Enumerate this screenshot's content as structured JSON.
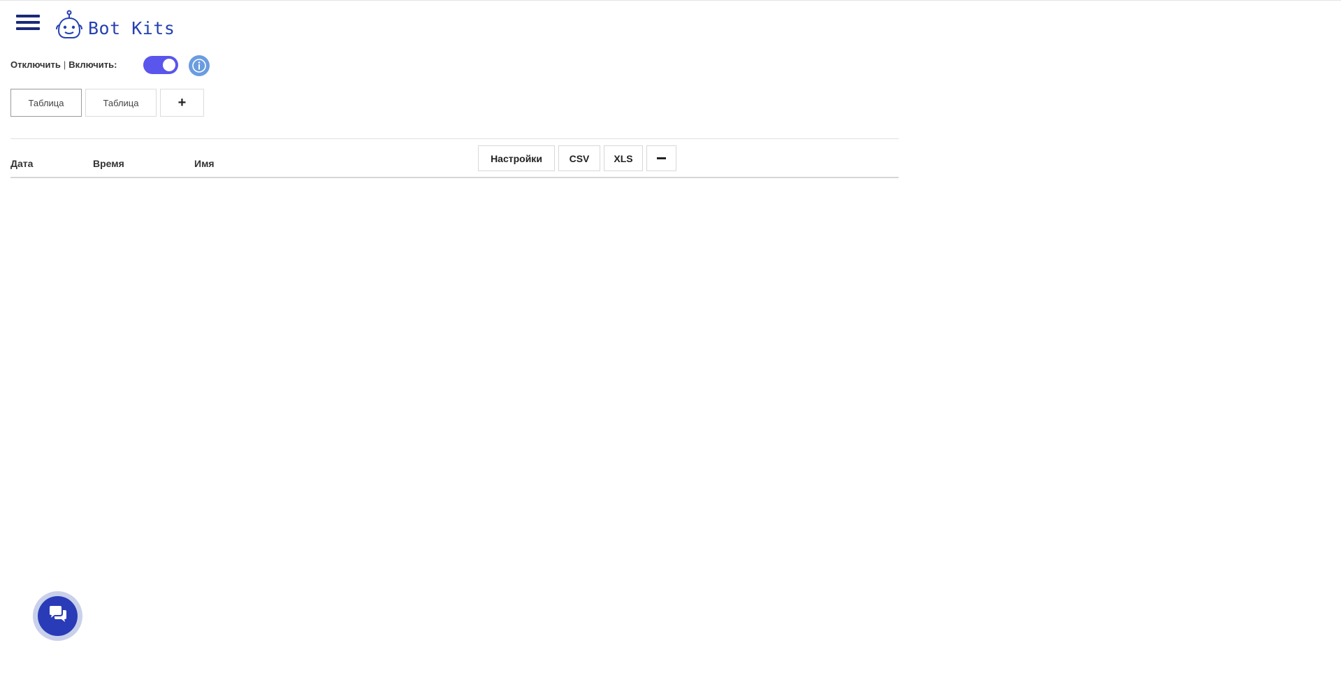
{
  "header": {
    "logo_text": "Bot Kits"
  },
  "toggle": {
    "label_off": "Отключить",
    "separator": "|",
    "label_on": "Включить:",
    "state": "on",
    "color": "#5a55ec"
  },
  "tabs": [
    {
      "label": "Таблица",
      "active": true
    },
    {
      "label": "Таблица",
      "active": false
    }
  ],
  "add_tab_label": "+",
  "table": {
    "columns": [
      "Дата",
      "Время",
      "Имя"
    ],
    "rows": []
  },
  "toolbar": {
    "settings_label": "Настройки",
    "csv_label": "CSV",
    "xls_label": "XLS"
  },
  "colors": {
    "brand": "#2541b2",
    "hamburger": "#1a2a7a",
    "info": "#6a9ce0",
    "chat": "#2a3bb8"
  },
  "icons": {
    "menu": "hamburger-icon",
    "logo": "robot-icon",
    "info": "info-icon",
    "chat": "chat-icon"
  }
}
